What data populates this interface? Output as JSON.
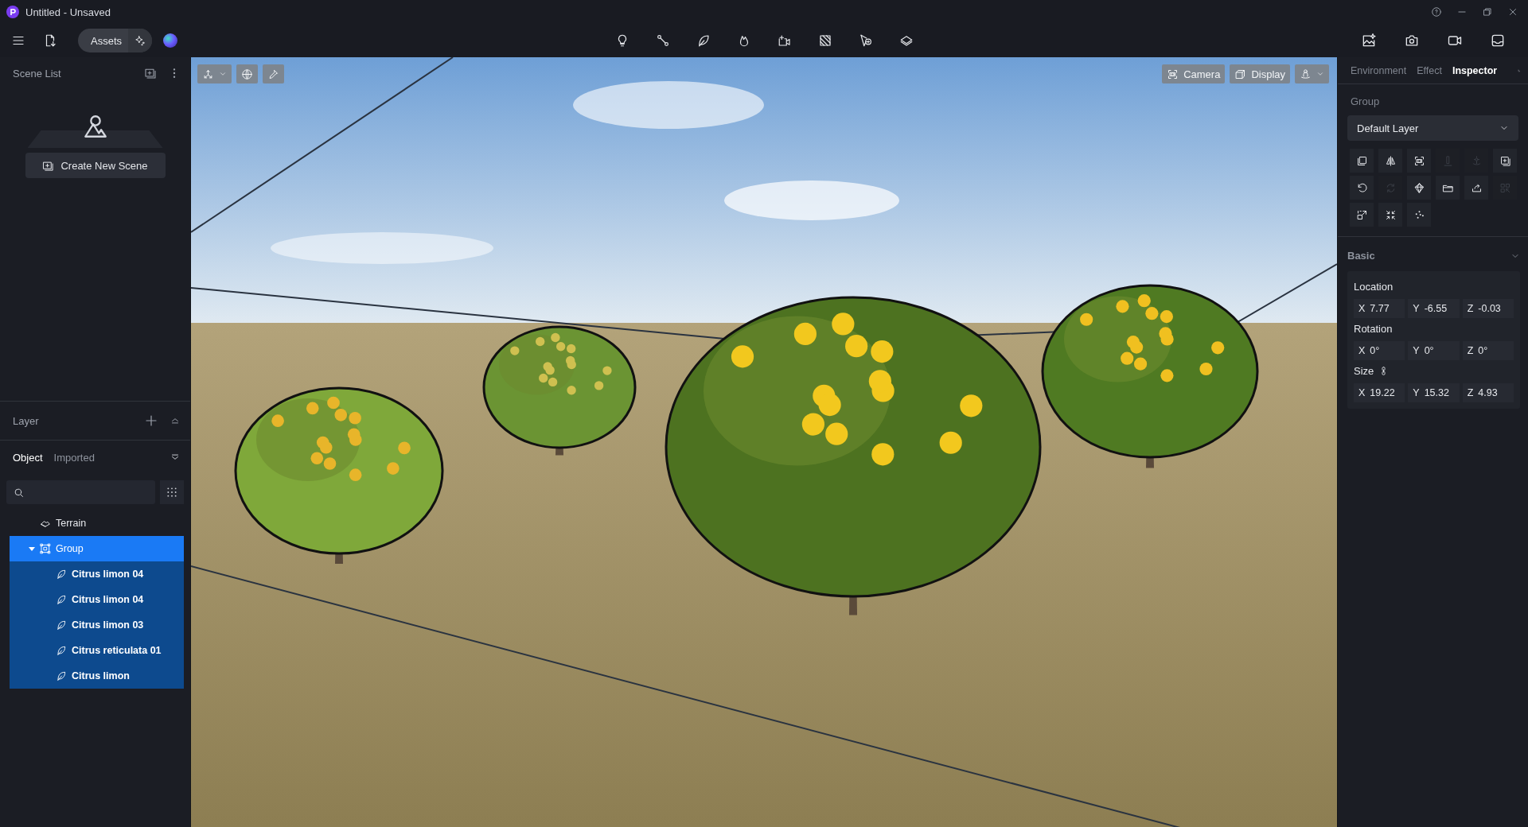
{
  "window": {
    "title": "Untitled - Unsaved"
  },
  "toolbar": {
    "assets_label": "Assets"
  },
  "scene_list": {
    "title": "Scene List",
    "create_button": "Create New Scene"
  },
  "layer": {
    "title": "Layer"
  },
  "object_tabs": [
    {
      "label": "Object",
      "selected": true
    },
    {
      "label": "Imported",
      "selected": false
    }
  ],
  "tree": [
    {
      "label": "Terrain",
      "kind": "terrain",
      "selected": false
    },
    {
      "label": "Group",
      "kind": "group",
      "selected": true,
      "expanded": true,
      "children": [
        {
          "label": "Citrus limon 04",
          "kind": "plant",
          "selected": false
        },
        {
          "label": "Citrus limon 04",
          "kind": "plant",
          "selected": false
        },
        {
          "label": "Citrus limon 03",
          "kind": "plant",
          "selected": false
        },
        {
          "label": "Citrus reticulata 01",
          "kind": "plant",
          "selected": false
        },
        {
          "label": "Citrus limon",
          "kind": "plant",
          "selected": false
        }
      ]
    }
  ],
  "viewport": {
    "camera_button": "Camera",
    "display_button": "Display"
  },
  "right_tabs": [
    {
      "label": "Environment",
      "selected": false
    },
    {
      "label": "Effect",
      "selected": false
    },
    {
      "label": "Inspector",
      "selected": true
    }
  ],
  "inspector": {
    "section_label": "Group",
    "layer_select": "Default Layer",
    "tools": [
      {
        "kind": "duplicate",
        "disabled": false
      },
      {
        "kind": "mirror",
        "disabled": false
      },
      {
        "kind": "focus",
        "disabled": false
      },
      {
        "kind": "pin",
        "disabled": true
      },
      {
        "kind": "light",
        "disabled": true
      },
      {
        "kind": "add",
        "disabled": false
      },
      {
        "kind": "undo",
        "disabled": false
      },
      {
        "kind": "refresh",
        "disabled": true
      },
      {
        "kind": "crystal",
        "disabled": false
      },
      {
        "kind": "folder",
        "disabled": false
      },
      {
        "kind": "share",
        "disabled": false
      },
      {
        "kind": "grid",
        "disabled": true
      },
      {
        "kind": "scale",
        "disabled": false
      },
      {
        "kind": "collapse",
        "disabled": false
      },
      {
        "kind": "scatter",
        "disabled": false
      }
    ],
    "basic_title": "Basic",
    "groups": [
      {
        "label": "Location",
        "fields": [
          {
            "axis": "X",
            "value": "7.77"
          },
          {
            "axis": "Y",
            "value": "-6.55"
          },
          {
            "axis": "Z",
            "value": "-0.03"
          }
        ]
      },
      {
        "label": "Rotation",
        "fields": [
          {
            "axis": "X",
            "value": "0°"
          },
          {
            "axis": "Y",
            "value": "0°"
          },
          {
            "axis": "Z",
            "value": "0°"
          }
        ]
      },
      {
        "label": "Size",
        "linked": true,
        "fields": [
          {
            "axis": "X",
            "value": "19.22"
          },
          {
            "axis": "Y",
            "value": "15.32"
          },
          {
            "axis": "Z",
            "value": "4.93"
          }
        ]
      }
    ]
  }
}
